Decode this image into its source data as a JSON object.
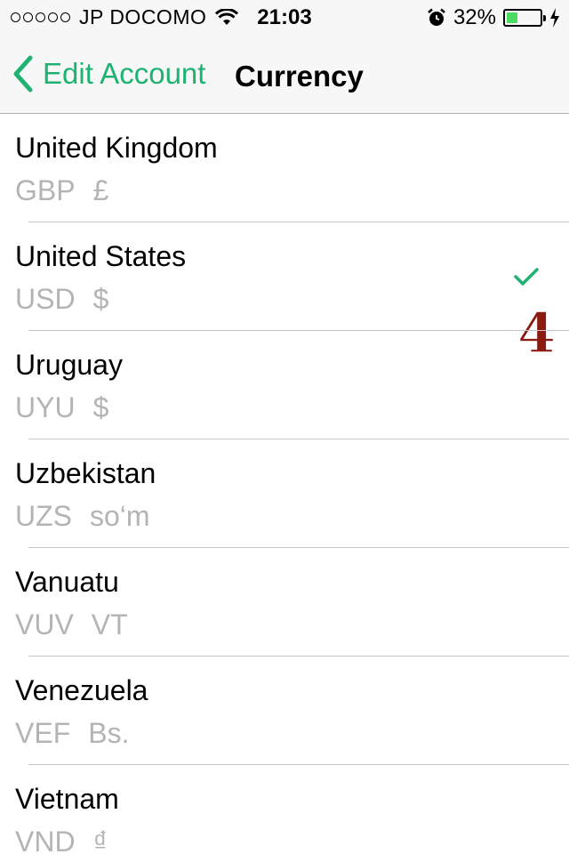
{
  "status_bar": {
    "carrier": "JP DOCOMO",
    "time": "21:03",
    "battery_percent": "32%",
    "battery_level": 0.32,
    "icons": [
      "signal-dots-icon",
      "wifi-icon",
      "alarm-icon",
      "battery-icon",
      "charging-bolt-icon"
    ]
  },
  "nav": {
    "back_label": "Edit Account",
    "title": "Currency"
  },
  "list": {
    "items": [
      {
        "country": "United Kingdom",
        "code": "GBP",
        "symbol": "£"
      },
      {
        "country": "United States",
        "code": "USD",
        "symbol": "$"
      },
      {
        "country": "Uruguay",
        "code": "UYU",
        "symbol": "$"
      },
      {
        "country": "Uzbekistan",
        "code": "UZS",
        "symbol": "so‘m"
      },
      {
        "country": "Vanuatu",
        "code": "VUV",
        "symbol": "VT"
      },
      {
        "country": "Venezuela",
        "code": "VEF",
        "symbol": "Bs."
      },
      {
        "country": "Vietnam",
        "code": "VND",
        "symbol": "₫"
      }
    ],
    "selected_index": 1,
    "annotation": "4"
  },
  "colors": {
    "accent": "#1fb271",
    "secondary_text": "#b4b4b4",
    "annotation": "#8b1a10"
  }
}
